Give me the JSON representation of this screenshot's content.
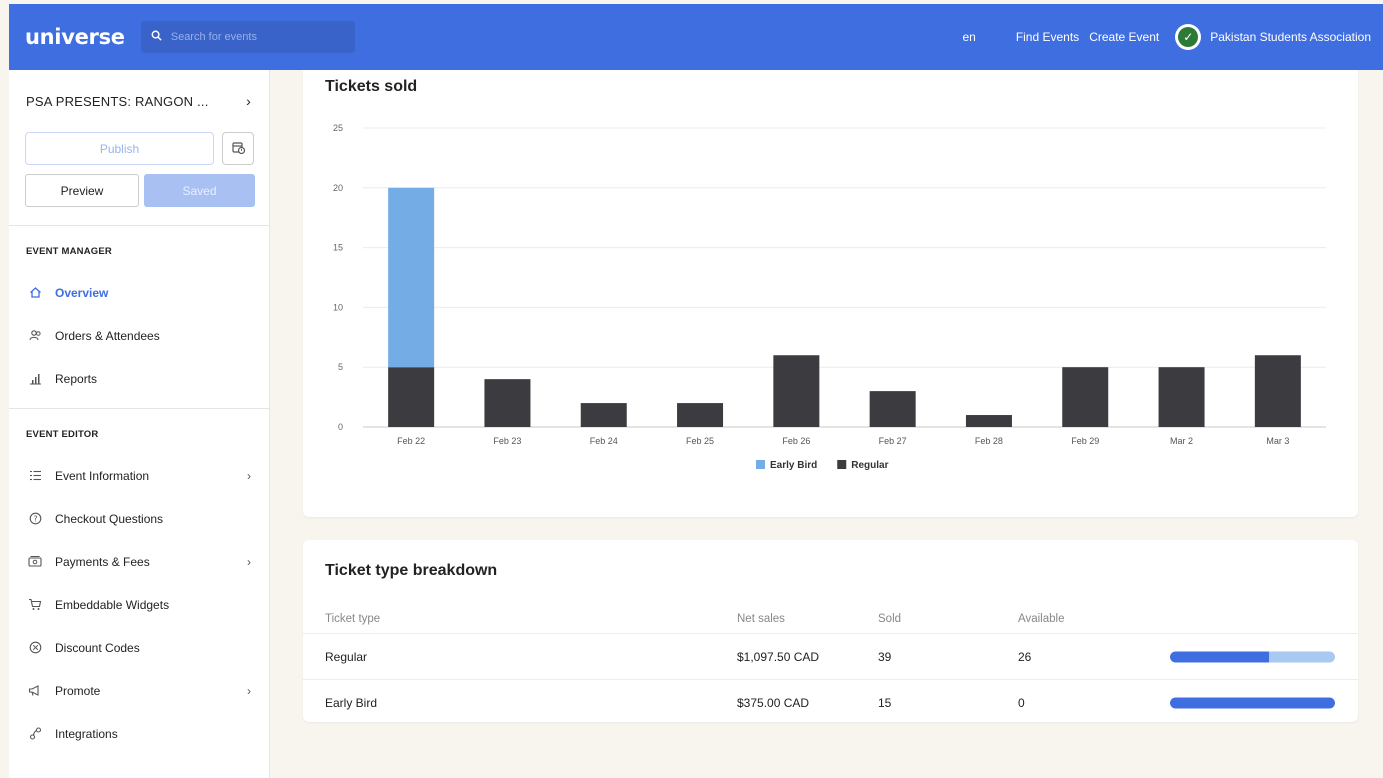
{
  "topbar": {
    "logo": "universe",
    "search_placeholder": "Search for events",
    "lang": "en",
    "find_events": "Find Events",
    "create_event": "Create Event",
    "org_name": "Pakistan Students Association"
  },
  "sidebar": {
    "event_title": "PSA PRESENTS: RANGON ...",
    "publish_label": "Publish",
    "preview_label": "Preview",
    "saved_label": "Saved",
    "manager_title": "EVENT MANAGER",
    "manager_items": [
      {
        "label": "Overview",
        "icon": "home-icon",
        "active": true
      },
      {
        "label": "Orders & Attendees",
        "icon": "people-icon"
      },
      {
        "label": "Reports",
        "icon": "bar-chart-icon"
      }
    ],
    "editor_title": "EVENT EDITOR",
    "editor_items": [
      {
        "label": "Event Information",
        "icon": "list-icon",
        "chevron": true
      },
      {
        "label": "Checkout Questions",
        "icon": "question-icon"
      },
      {
        "label": "Payments & Fees",
        "icon": "wallet-icon",
        "chevron": true
      },
      {
        "label": "Embeddable Widgets",
        "icon": "cart-icon"
      },
      {
        "label": "Discount Codes",
        "icon": "discount-icon"
      },
      {
        "label": "Promote",
        "icon": "megaphone-icon",
        "chevron": true
      },
      {
        "label": "Integrations",
        "icon": "link-icon"
      }
    ]
  },
  "tickets_chart": {
    "title": "Tickets sold"
  },
  "chart_data": {
    "type": "bar",
    "stacked": true,
    "title": "Tickets sold",
    "categories": [
      "Feb 22",
      "Feb 23",
      "Feb 24",
      "Feb 25",
      "Feb 26",
      "Feb 27",
      "Feb 28",
      "Feb 29",
      "Mar 2",
      "Mar 3"
    ],
    "series": [
      {
        "name": "Regular",
        "color": "#3b3b40",
        "values": [
          5,
          4,
          2,
          2,
          6,
          3,
          1,
          5,
          5,
          6
        ]
      },
      {
        "name": "Early Bird",
        "color": "#74ade6",
        "values": [
          15,
          0,
          0,
          0,
          0,
          0,
          0,
          0,
          0,
          0
        ]
      }
    ],
    "ylim": [
      0,
      25
    ],
    "yticks": [
      0,
      5,
      10,
      15,
      20,
      25
    ],
    "grid": true,
    "legend": "bottom-center",
    "legend_order": [
      "Early Bird",
      "Regular"
    ]
  },
  "breakdown": {
    "title": "Ticket type breakdown",
    "headers": {
      "type": "Ticket type",
      "net": "Net sales",
      "sold": "Sold",
      "available": "Available"
    },
    "rows": [
      {
        "type": "Regular",
        "net": "$1,097.50 CAD",
        "sold": "39",
        "available": "26",
        "sold_fraction": 0.6
      },
      {
        "type": "Early Bird",
        "net": "$375.00 CAD",
        "sold": "15",
        "available": "0",
        "sold_fraction": 1.0
      }
    ]
  }
}
